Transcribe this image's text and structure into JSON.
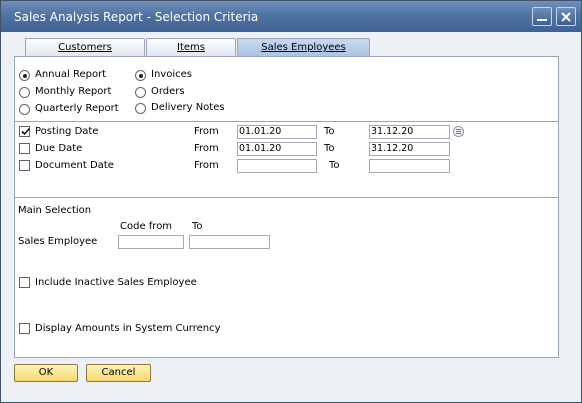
{
  "window": {
    "title": "Sales Analysis Report - Selection Criteria"
  },
  "tabs": [
    {
      "label": "Customers",
      "active": false
    },
    {
      "label": "Items",
      "active": false
    },
    {
      "label": "Sales Employees",
      "active": true
    }
  ],
  "report_type": {
    "options": [
      {
        "label": "Annual Report",
        "selected": true
      },
      {
        "label": "Monthly Report",
        "selected": false
      },
      {
        "label": "Quarterly Report",
        "selected": false
      }
    ]
  },
  "doc_type": {
    "options": [
      {
        "label": "Invoices",
        "selected": true
      },
      {
        "label": "Orders",
        "selected": false
      },
      {
        "label": "Delivery Notes",
        "selected": false
      }
    ]
  },
  "dates": [
    {
      "label": "Posting Date",
      "checked": true,
      "from_label": "From",
      "from": "01.01.20",
      "to_label": "To",
      "to": "31.12.20"
    },
    {
      "label": "Due Date",
      "checked": false,
      "from_label": "From",
      "from": "01.01.20",
      "to_label": "To",
      "to": "31.12.20"
    },
    {
      "label": "Document Date",
      "checked": false,
      "from_label": "From",
      "from": "",
      "to_label": "To",
      "to": ""
    }
  ],
  "main_selection": {
    "title": "Main Selection",
    "code_from_label": "Code from",
    "to_label": "To",
    "row_label": "Sales Employee",
    "code_from": "",
    "code_to": ""
  },
  "options": {
    "include_inactive": {
      "label": "Include Inactive Sales Employee",
      "checked": false
    },
    "system_currency": {
      "label": "Display Amounts in System Currency",
      "checked": false
    }
  },
  "buttons": {
    "ok": "OK",
    "cancel": "Cancel"
  },
  "colors": {
    "title_bar": "#4f73a3",
    "button": "#f4d770",
    "active_tab": "#a8c2e6"
  }
}
